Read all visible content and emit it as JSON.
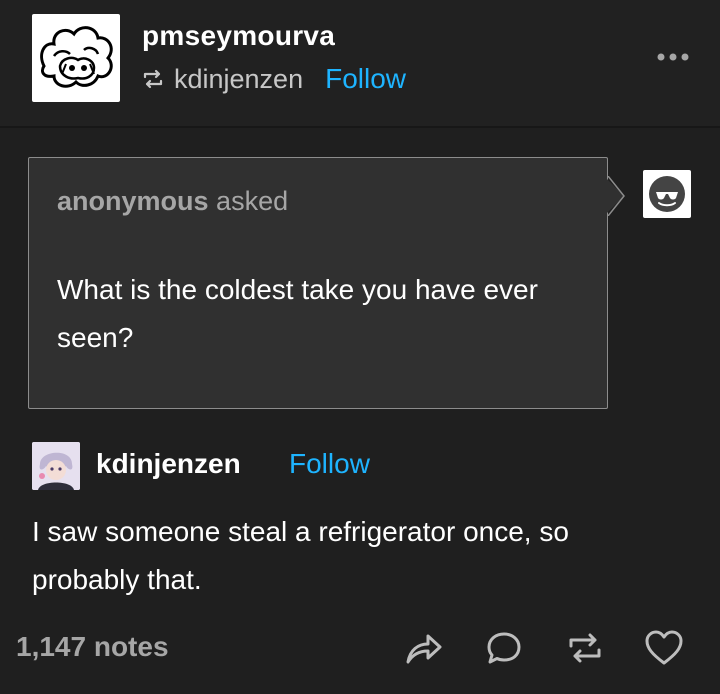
{
  "post": {
    "blog_name": "pmseymourva",
    "reblogged_from": "kdinjenzen",
    "follow_label": "Follow"
  },
  "ask": {
    "asker": "anonymous",
    "asked_label": "asked",
    "question": "What is the coldest take you have ever seen?"
  },
  "answer": {
    "username": "kdinjenzen",
    "follow_label": "Follow",
    "text": "I saw someone steal a refrigerator once, so probably that."
  },
  "footer": {
    "notes": "1,147 notes",
    "actions": [
      "share-icon",
      "reply-icon",
      "reblog-icon",
      "like-icon"
    ]
  },
  "colors": {
    "background": "#1f1f1f",
    "link": "#1eb4ff",
    "muted": "#a6a6a6",
    "ask_bg": "#303030"
  }
}
